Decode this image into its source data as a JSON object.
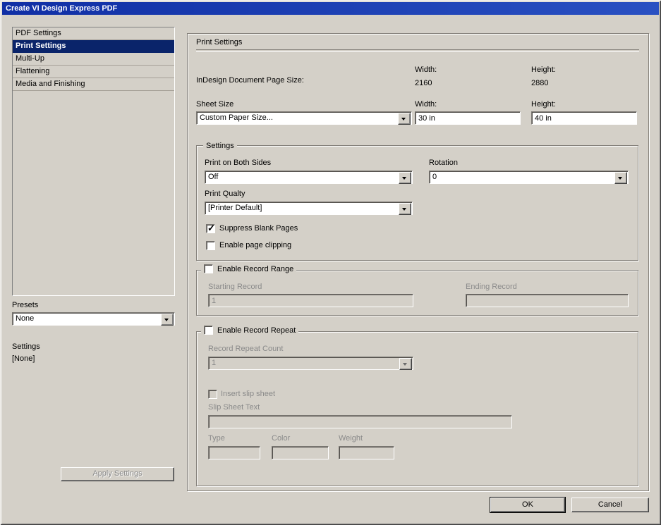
{
  "colors": {
    "dialog_bg": "#d4d0c8",
    "titlebar_blue": "#1b38ad",
    "selection_blue": "#0a246a",
    "disabled_text": "#8a8a8a"
  },
  "window": {
    "title": "Create VI Design Express PDF"
  },
  "sidebar": {
    "items": [
      {
        "label": "PDF Settings",
        "selected": false
      },
      {
        "label": "Print Settings",
        "selected": true
      },
      {
        "label": "Multi-Up",
        "selected": false
      },
      {
        "label": "Flattening",
        "selected": false
      },
      {
        "label": "Media and Finishing",
        "selected": false
      }
    ],
    "presets_label": "Presets",
    "presets_value": "None",
    "settings_label": "Settings",
    "settings_value": "[None]",
    "apply_button_label": "Apply Settings"
  },
  "main": {
    "heading": "Print Settings",
    "document_page_size": {
      "label": "InDesign Document Page Size:",
      "width_label": "Width:",
      "width_value": "2160",
      "height_label": "Height:",
      "height_value": "2880"
    },
    "sheet_size": {
      "label": "Sheet Size",
      "selected": "Custom Paper Size...",
      "width_label": "Width:",
      "width_value": "30 in",
      "height_label": "Height:",
      "height_value": "40 in"
    },
    "settings_group": {
      "title": "Settings",
      "print_on_both_sides": {
        "label": "Print on Both Sides",
        "value": "Off"
      },
      "rotation": {
        "label": "Rotation",
        "value": "0"
      },
      "print_quality": {
        "label": "Print Qualty",
        "value": "[Printer Default]"
      },
      "suppress_blank_pages": {
        "label": "Suppress Blank Pages",
        "checked": true
      },
      "enable_page_clipping": {
        "label": "Enable page clipping",
        "checked": false
      }
    },
    "record_range_group": {
      "title": "Enable Record Range",
      "checked": false,
      "starting_record": {
        "label": "Starting Record",
        "value": "1"
      },
      "ending_record": {
        "label": "Ending Record",
        "value": ""
      }
    },
    "record_repeat_group": {
      "title": "Enable Record Repeat",
      "checked": false,
      "record_repeat_count": {
        "label": "Record Repeat Count",
        "value": "1"
      },
      "insert_slip_sheet": {
        "label": "Insert slip sheet",
        "checked": false
      },
      "slip_sheet_text": {
        "label": "Slip Sheet Text",
        "value": ""
      },
      "type_label": "Type",
      "color_label": "Color",
      "weight_label": "Weight"
    }
  },
  "footer": {
    "ok_label": "OK",
    "cancel_label": "Cancel"
  }
}
